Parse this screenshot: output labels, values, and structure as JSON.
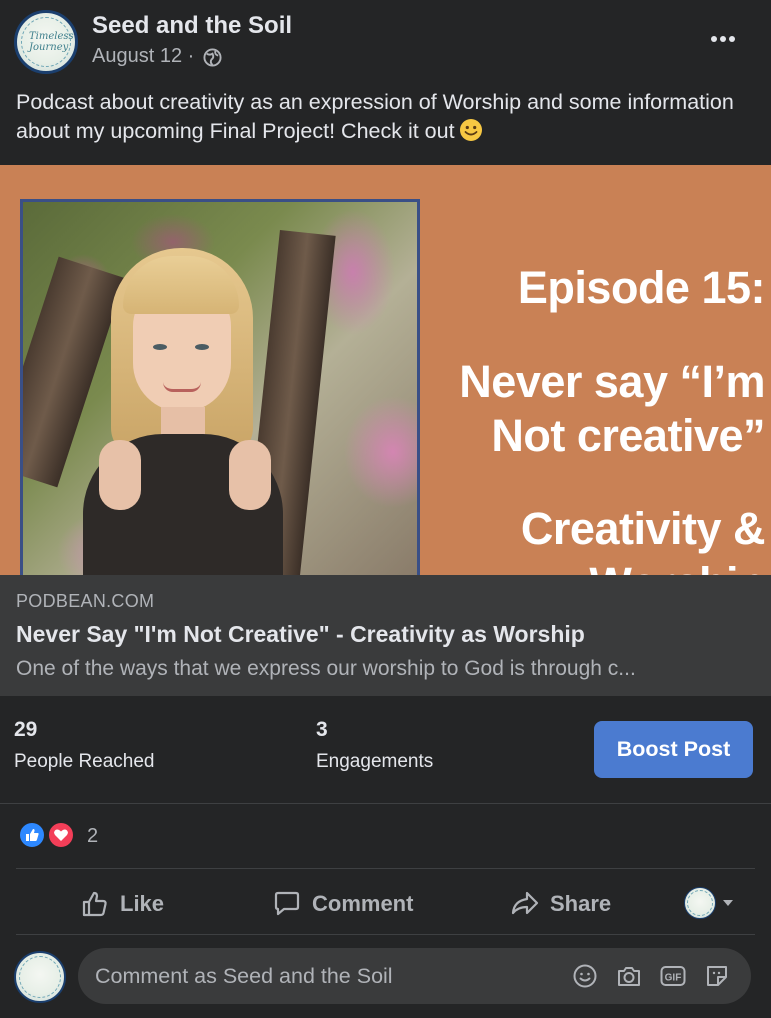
{
  "post": {
    "page_name": "Seed and the Soil",
    "date": "August 12 ·",
    "avatar_text": "Timeless Journey",
    "text": "Podcast about creativity as an expression of Worship and some information about my upcoming Final Project! Check it out"
  },
  "banner": {
    "episode": "Episode 15:",
    "title_line1": "Never say “I’m",
    "title_line2": "Not creative”",
    "title_line3": "Creativity  &",
    "title_line4": "Worship"
  },
  "link_preview": {
    "domain": "PODBEAN.COM",
    "title": "Never Say \"I'm Not Creative\" - Creativity as Worship",
    "description": "One of the ways that we express our worship to God is through c..."
  },
  "stats": {
    "reached_count": "29",
    "reached_label": "People Reached",
    "engagements_count": "3",
    "engagements_label": "Engagements",
    "boost_label": "Boost Post"
  },
  "reactions": {
    "count": "2",
    "types": [
      "like-icon",
      "love-icon"
    ]
  },
  "actions": {
    "like": "Like",
    "comment": "Comment",
    "share": "Share"
  },
  "comment": {
    "placeholder": "Comment as Seed and the Soil",
    "icons": [
      "emoji-icon",
      "camera-icon",
      "gif-icon",
      "sticker-icon"
    ]
  },
  "colors": {
    "background": "#242526",
    "banner": "#c98155",
    "link_preview": "#3a3b3c",
    "boost": "#4b7bd0",
    "like_blue": "#2d88ff",
    "love_red": "#f33e58"
  }
}
